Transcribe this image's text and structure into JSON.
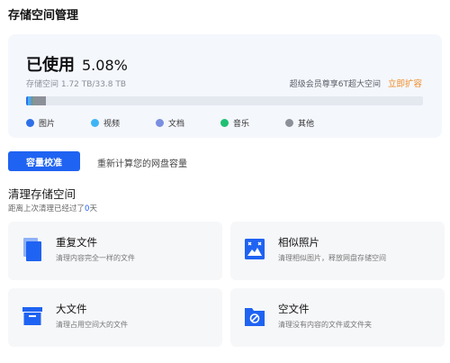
{
  "header": {
    "title": "存储空间管理"
  },
  "storage": {
    "used_label": "已使用",
    "used_percent": "5.08%",
    "space_info": "存储空间 1.72 TB/33.8 TB",
    "vip_note": "超级会员尊享6T超大空间",
    "expand_link": "立即扩容",
    "usage_fraction": 0.0508,
    "segments": [
      {
        "name": "pictures",
        "color": "#2f6fe8",
        "fraction": 0.004
      },
      {
        "name": "videos",
        "color": "#3fb4f5",
        "fraction": 0.006
      },
      {
        "name": "documents",
        "color": "#7a8fe0",
        "fraction": 0.004
      },
      {
        "name": "music",
        "color": "#1fbf72",
        "fraction": 0.002
      },
      {
        "name": "other",
        "color": "#8c9099",
        "fraction": 0.035
      }
    ],
    "legend": [
      {
        "label": "图片",
        "color": "#2f6fe8"
      },
      {
        "label": "视频",
        "color": "#3fb4f5"
      },
      {
        "label": "文档",
        "color": "#7a8fe0"
      },
      {
        "label": "音乐",
        "color": "#1fbf72"
      },
      {
        "label": "其他",
        "color": "#8c9099"
      }
    ]
  },
  "calibration": {
    "button_label": "容量校准",
    "description": "重新计算您的网盘容量"
  },
  "clean": {
    "title": "清理存储空间",
    "subtitle_prefix": "距离上次清理已经过了",
    "days": "0",
    "subtitle_suffix": "天",
    "accent_color": "#1f63f2",
    "tools": [
      {
        "icon": "duplicate-files-icon",
        "title": "重复文件",
        "desc": "清理内容完全一样的文件"
      },
      {
        "icon": "similar-photos-icon",
        "title": "相似照片",
        "desc": "清理相似图片，释放网盘存储空间"
      },
      {
        "icon": "large-files-icon",
        "title": "大文件",
        "desc": "清理占用空间大的文件"
      },
      {
        "icon": "empty-files-icon",
        "title": "空文件",
        "desc": "清理没有内容的文件或文件夹"
      }
    ]
  }
}
